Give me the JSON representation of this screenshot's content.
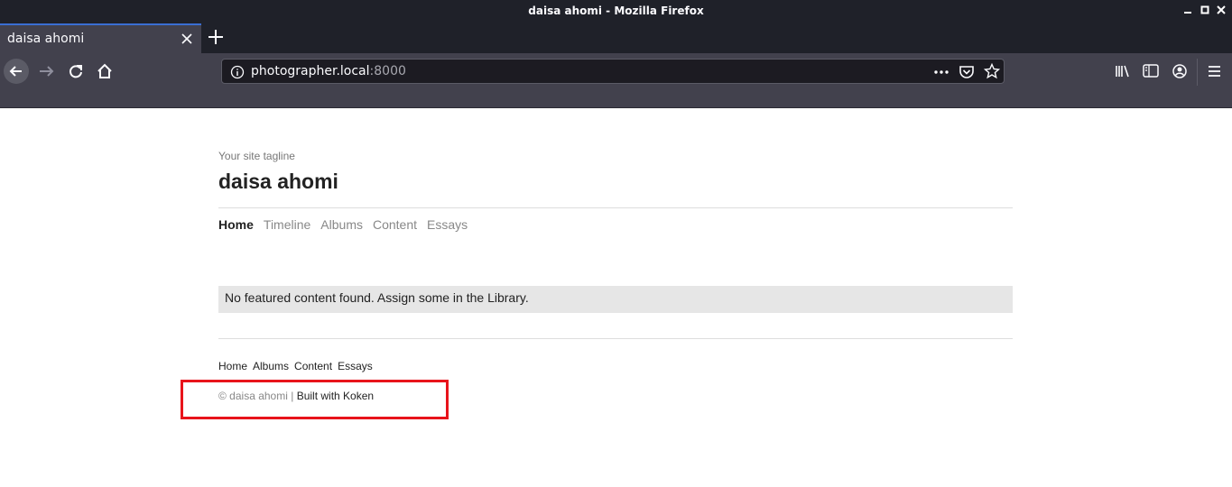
{
  "window": {
    "title": "daisa ahomi - Mozilla Firefox"
  },
  "tab": {
    "label": "daisa ahomi"
  },
  "urlbar": {
    "host": "photographer.local",
    "port": ":8000"
  },
  "site": {
    "tagline": "Your site tagline",
    "title": "daisa ahomi",
    "nav": [
      "Home",
      "Timeline",
      "Albums",
      "Content",
      "Essays"
    ],
    "notice": "No featured content found. Assign some in the Library.",
    "footer_nav": [
      "Home",
      "Albums",
      "Content",
      "Essays"
    ],
    "copyright": "© daisa ahomi |",
    "built_with": "Built with Koken"
  },
  "colors": {
    "highlight": "#e8141b",
    "tab_accent": "#3a6ed3"
  }
}
